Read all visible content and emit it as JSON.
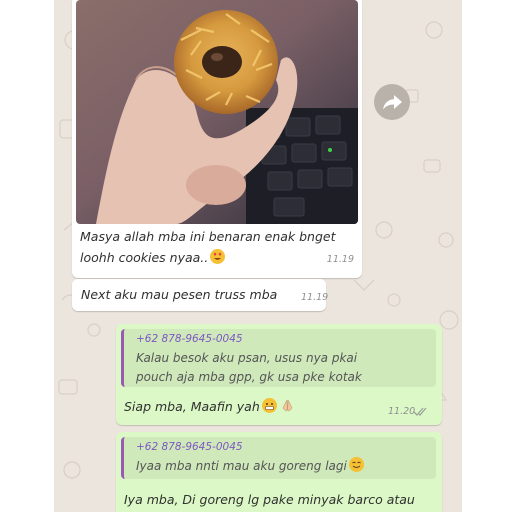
{
  "messages": [
    {
      "type": "image",
      "caption_line1": "Masya allah mba ini benaran enak bnget",
      "caption_line2": "loohh cookies nyaa..",
      "time": "11.19"
    },
    {
      "type": "text",
      "text": "Next aku mau pesen truss mba",
      "time": "11.19"
    },
    {
      "type": "reply",
      "quote_sender": "+62 878-9645-0045",
      "quote_line1": "Kalau besok aku psan, usus nya pkai",
      "quote_line2": "pouch aja mba gpp, gk usa pke kotak",
      "text": "Siap mba, Maafin yah",
      "time": "11.20"
    },
    {
      "type": "reply",
      "quote_sender": "+62 878-9645-0045",
      "quote_line1": "Iyaa mba nnti mau aku goreng lagi",
      "text": "Iya mba, Di goreng lg pake minyak barco atau"
    }
  ],
  "colors": {
    "chat_bg": "#ece5dd",
    "incoming": "#ffffff",
    "outgoing": "#dcf8c6",
    "quote_bar": "#9b59b6",
    "quote_sender": "#7e57c2"
  },
  "icons": [
    "forward-icon",
    "double-check-icon",
    "heart-eyes-emoji",
    "grimace-emoji",
    "folded-hands-emoji",
    "smile-emoji"
  ]
}
